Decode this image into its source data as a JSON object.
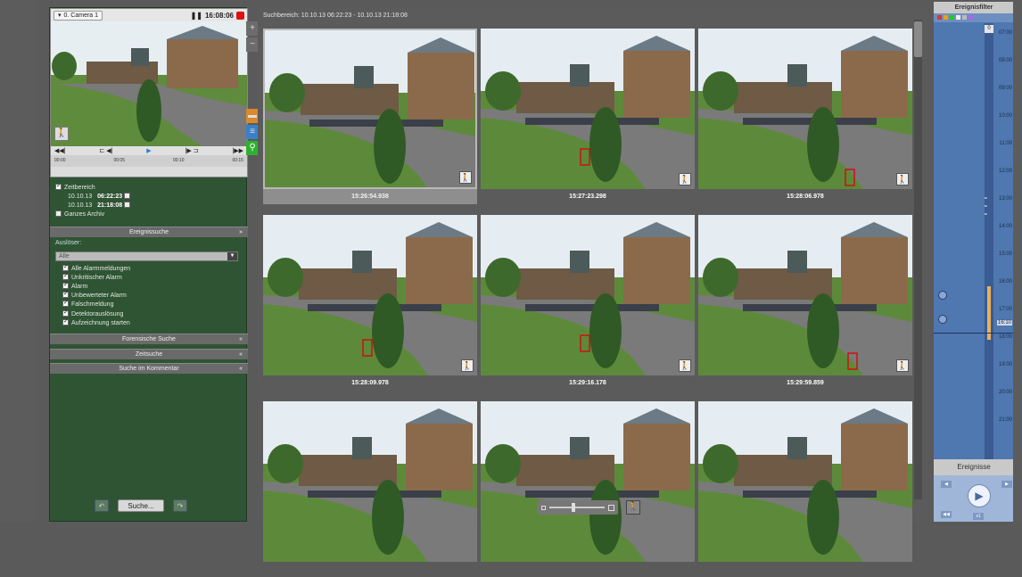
{
  "camera": {
    "name": "0. Camera 1",
    "time": "16:08:06",
    "timeline_ticks": [
      "00:00",
      "00:05",
      "00:10",
      "00:15"
    ]
  },
  "search_range": {
    "zeitbereich_label": "Zeitbereich",
    "from_date": "10.10.13",
    "from_time": "06:22:23",
    "to_date": "10.10.13",
    "to_time": "21:18:08",
    "ganzes_archiv": "Ganzes Archiv"
  },
  "sections": {
    "ereignissuche": "Ereignissuche",
    "forensische": "Forensische Suche",
    "zeitsuche": "Zeitsuche",
    "kommentar": "Suche im Kommentar"
  },
  "ausloser": {
    "label": "Auslöser:",
    "selected": "Alle"
  },
  "checklist": [
    "Alle Alarmmeldungen",
    "Unkritischer Alarm",
    "Alarm",
    "Unbewerteter Alarm",
    "Falschmeldung",
    "Detektorauslösung",
    "Aufzeichnung starten"
  ],
  "buttons": {
    "search": "Suche..."
  },
  "center": {
    "title": "Suchbereich:  10.10.13 06:22:23 - 10.10.13 21:18:08"
  },
  "thumbnails": [
    {
      "time": "15:26:54.938",
      "selected": true
    },
    {
      "time": "15:27:23.298"
    },
    {
      "time": "15:28:06.978"
    },
    {
      "time": "15:28:09.978"
    },
    {
      "time": "15:29:16.178"
    },
    {
      "time": "15:29:59.859"
    },
    {
      "time": ""
    },
    {
      "time": ""
    },
    {
      "time": ""
    }
  ],
  "right": {
    "title": "Ereignisfilter",
    "counter": "0",
    "hours": [
      "07:00",
      "08:00",
      "09:00",
      "10:00",
      "11:00",
      "12:00",
      "13:00",
      "14:00",
      "15:00",
      "16:00",
      "16:10",
      "17:00",
      "18:00",
      "19:00",
      "20:00",
      "21:00"
    ],
    "events_title": "Ereignisse"
  },
  "colors": {
    "left_panel": "#2f5434",
    "right_panel": "#4f77b0",
    "recording": "#dd1111",
    "motion_box": "#cc1111"
  }
}
